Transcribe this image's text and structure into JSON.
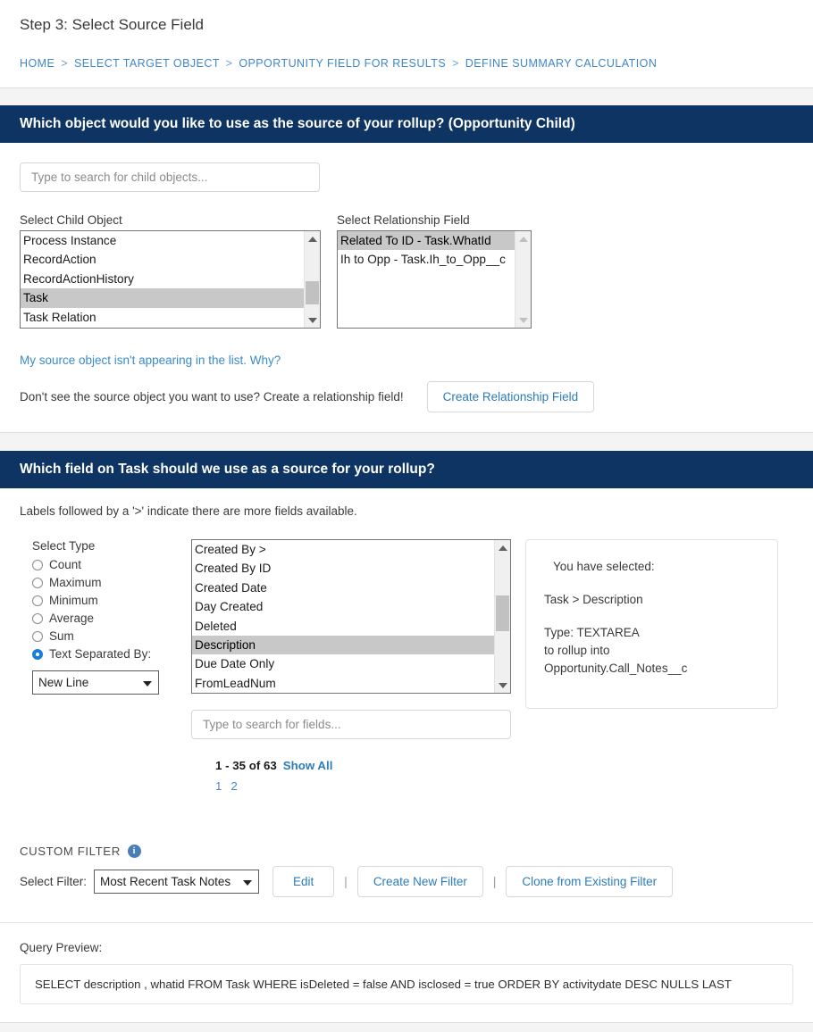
{
  "header": {
    "title": "Step 3: Select Source Field",
    "breadcrumb": [
      "HOME",
      "SELECT TARGET OBJECT",
      "OPPORTUNITY FIELD FOR RESULTS",
      "DEFINE SUMMARY CALCULATION"
    ],
    "breadcrumb_separator": ">"
  },
  "source_section": {
    "banner": "Which object would you like to use as the source of your rollup? (Opportunity Child)",
    "search": {
      "value": "",
      "placeholder": "Type to search for child objects..."
    },
    "child_object": {
      "label": "Select Child Object",
      "options": [
        "Process Instance",
        "RecordAction",
        "RecordActionHistory",
        "Task",
        "Task Relation"
      ],
      "selected": "Task"
    },
    "relationship_field": {
      "label": "Select Relationship Field",
      "options": [
        "Related To ID - Task.WhatId",
        "Ih to Opp - Task.Ih_to_Opp__c"
      ],
      "selected": "Related To ID - Task.WhatId"
    },
    "help_link": "My source object isn't appearing in the list. Why?",
    "create_rel_text": "Don't see the source object you want to use? Create a relationship field!",
    "create_rel_button": "Create Relationship Field"
  },
  "field_section": {
    "banner": "Which field on Task should we use as a source for your rollup?",
    "hint": "Labels followed by a '>' indicate there are more fields available.",
    "type": {
      "label": "Select Type",
      "options": [
        {
          "label": "Count",
          "checked": false
        },
        {
          "label": "Maximum",
          "checked": false
        },
        {
          "label": "Minimum",
          "checked": false
        },
        {
          "label": "Average",
          "checked": false
        },
        {
          "label": "Sum",
          "checked": false
        },
        {
          "label": "Text Separated By:",
          "checked": true
        }
      ],
      "separator_value": "New Line"
    },
    "fields": {
      "options": [
        "Created By >",
        "Created By ID",
        "Created Date",
        "Day Created",
        "Deleted",
        "Description",
        "Due Date Only",
        "FromLeadNum"
      ],
      "selected": "Description"
    },
    "field_search": {
      "value": "",
      "placeholder": "Type to search for fields..."
    },
    "pagination": {
      "range": "1 - 35 of 63",
      "show_all": "Show All",
      "pages": [
        "1",
        "2"
      ],
      "current_page": "1"
    },
    "summary": {
      "heading": "You have selected:",
      "selection": "Task > Description",
      "type_line": "Type: TEXTAREA",
      "rollup_line": "to rollup into",
      "target_line": "Opportunity.Call_Notes__c"
    }
  },
  "custom_filter": {
    "title": "CUSTOM FILTER",
    "select_label": "Select Filter:",
    "selected_filter": "Most Recent Task Notes",
    "edit_button": "Edit",
    "create_button": "Create New Filter",
    "clone_button": "Clone from Existing Filter",
    "divider": "|"
  },
  "query_preview": {
    "label": "Query Preview:",
    "query": "SELECT description , whatid FROM Task WHERE isDeleted = false AND isclosed = true ORDER BY activitydate DESC NULLS LAST"
  },
  "colors": {
    "banner_navy": "#0d3463",
    "link_blue": "#3a8bc8",
    "radio_blue": "#1a7fd4",
    "selected_gray": "#c8c8c8"
  }
}
